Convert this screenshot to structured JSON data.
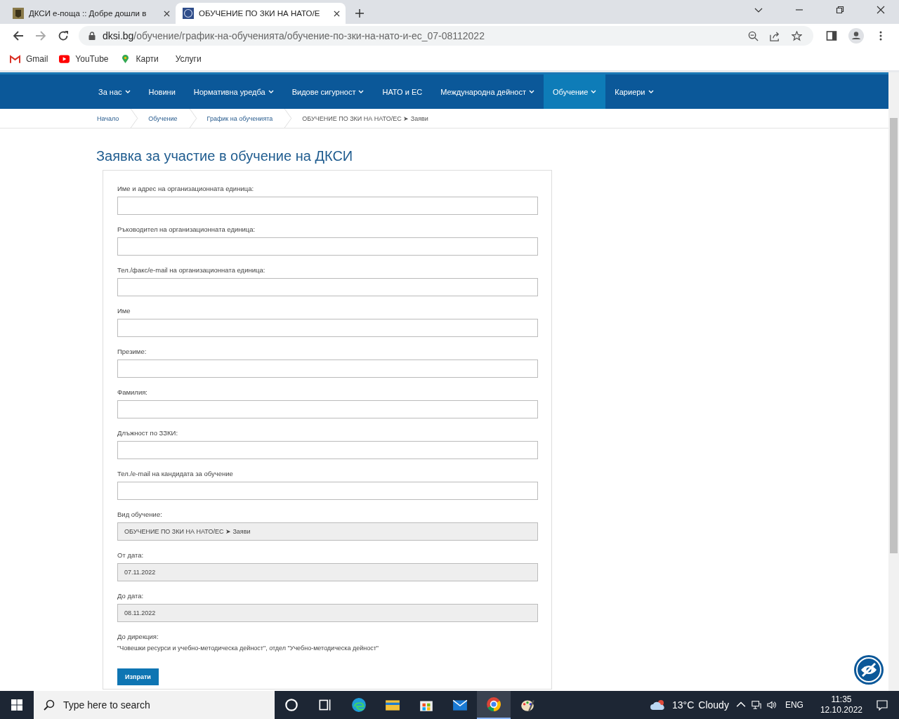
{
  "browser": {
    "tabs": [
      {
        "title": "ДКСИ е-поща :: Добре дошли в",
        "kind": "crest",
        "selected": false
      },
      {
        "title": "ОБУЧЕНИЕ ПО ЗКИ НА НАТО/Е",
        "kind": "seal",
        "selected": true
      }
    ],
    "address": {
      "domain": "dksi.bg",
      "path": "/обучение/график-на-обученията/обучение-по-зки-на-нато-и-ес_07-08112022"
    },
    "bookmarks": [
      {
        "label": "Gmail",
        "kind": "gmail"
      },
      {
        "label": "YouTube",
        "kind": "youtube"
      },
      {
        "label": "Карти",
        "kind": "maps"
      },
      {
        "label": "Услуги",
        "kind": "plain"
      }
    ]
  },
  "nav": {
    "items": [
      {
        "label": "За нас",
        "dropdown": true,
        "selected": false
      },
      {
        "label": "Новини",
        "dropdown": false,
        "selected": false
      },
      {
        "label": "Нормативна уредба",
        "dropdown": true,
        "selected": false
      },
      {
        "label": "Видове сигурност",
        "dropdown": true,
        "selected": false
      },
      {
        "label": "НАТО и ЕС",
        "dropdown": false,
        "selected": false
      },
      {
        "label": "Международна дейност",
        "dropdown": true,
        "selected": false
      },
      {
        "label": "Обучение",
        "dropdown": true,
        "selected": true
      },
      {
        "label": "Кариери",
        "dropdown": true,
        "selected": false
      }
    ]
  },
  "breadcrumbs": [
    "Начало",
    "Обучение",
    "График на обученията",
    "ОБУЧЕНИЕ ПО ЗКИ НА НАТО/ЕС ➤ Заяви"
  ],
  "title": "Заявка за участие в обучение на ДКСИ",
  "form": {
    "fields": [
      {
        "label": "Име и адрес на организационната единица:",
        "readonly": false
      },
      {
        "label": "Ръководител на организационната единица:",
        "readonly": false
      },
      {
        "label": "Тел./факс/e-mail на организационната единица:",
        "readonly": false
      },
      {
        "label": "Име",
        "readonly": false
      },
      {
        "label": "Презиме:",
        "readonly": false
      },
      {
        "label": "Фамилия:",
        "readonly": false
      },
      {
        "label": "Длъжност по ЗЗКИ:",
        "readonly": false
      },
      {
        "label": "Тел./e-mail на кандидата за обучение",
        "readonly": false
      },
      {
        "label": "Вид обучение:",
        "value": "ОБУЧЕНИЕ ПО ЗКИ НА НАТО/ЕС ➤ Заяви",
        "readonly": true
      },
      {
        "label": "От дата:",
        "value": "07.11.2022",
        "readonly": true
      },
      {
        "label": "До дата:",
        "value": "08.11.2022",
        "readonly": true
      }
    ],
    "direction": {
      "label": "До дирекция:",
      "text": "\"Човешки ресурси и учебно-методическа дейност\", отдел \"Учебно-методическа дейност\""
    },
    "submit": "Изпрати"
  },
  "taskbar": {
    "search": {
      "placeholder": "Type here to search"
    },
    "apps": [
      {
        "kind": "cortana",
        "selected": false
      },
      {
        "kind": "taskview",
        "selected": false
      },
      {
        "kind": "edge",
        "selected": false
      },
      {
        "kind": "explorer",
        "selected": false
      },
      {
        "kind": "store",
        "selected": false
      },
      {
        "kind": "mail",
        "selected": false
      },
      {
        "kind": "chrome",
        "selected": true
      },
      {
        "kind": "paint",
        "selected": false
      }
    ],
    "temperature": "13°C",
    "weather": "Cloudy",
    "language": "ENG",
    "time": "11:35",
    "date": "12.10.2022"
  }
}
